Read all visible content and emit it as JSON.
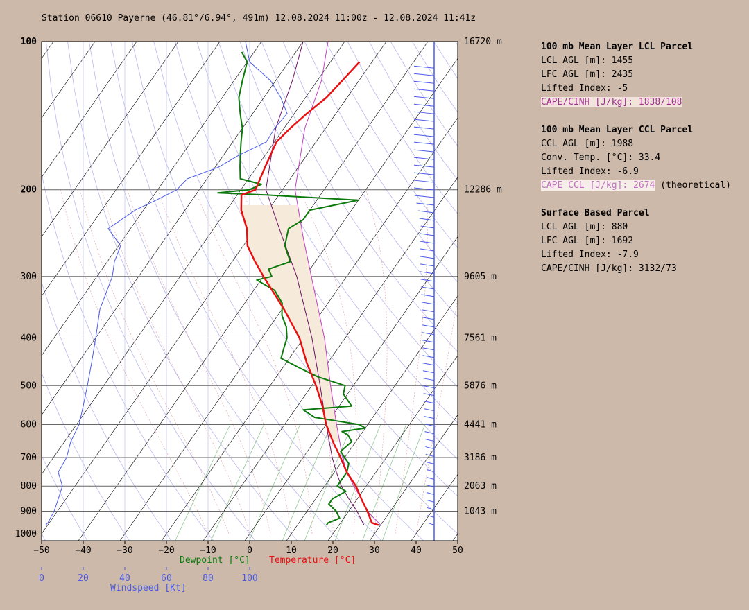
{
  "title": "Station 06610 Payerne (46.81°/6.94°, 491m) 12.08.2024 11:00z - 12.08.2024 11:41z",
  "axes": {
    "temp_ticks": [
      "−50",
      "−40",
      "−30",
      "−20",
      "−10",
      "0",
      "10",
      "20",
      "30",
      "40",
      "50"
    ],
    "wind_ticks": [
      "0",
      "20",
      "40",
      "60",
      "80",
      "100"
    ],
    "pressure_ticks": [
      "100",
      "200",
      "300",
      "400",
      "500",
      "600",
      "700",
      "800",
      "900",
      "1000"
    ],
    "height_labels": [
      "16720 m",
      "12286 m",
      "9605 m",
      "7561 m",
      "5876 m",
      "4441 m",
      "3186 m",
      "2063 m",
      "1043 m"
    ],
    "xlabel_dewpoint": "Dewpoint [°C]",
    "xlabel_temperature": "Temperature [°C]",
    "xlabel_wind": "Windspeed [Kt]"
  },
  "panel": {
    "lcl": {
      "header": "100 mb Mean Layer LCL Parcel",
      "lines": [
        "LCL AGL [m]: 1455",
        "LFC AGL [m]: 2435",
        "Lifted Index: -5"
      ],
      "cape": "CAPE/CINH [J/kg]: 1838/108"
    },
    "ccl": {
      "header": "100 mb Mean Layer CCL Parcel",
      "lines": [
        "CCL AGL [m]: 1988",
        "Conv. Temp. [°C]: 33.4",
        "Lifted Index: -6.9"
      ],
      "cape": "CAPE CCL [J/kg]: 2674",
      "note": " (theoretical)"
    },
    "sb": {
      "header": "Surface Based Parcel",
      "lines": [
        "LCL AGL [m]: 880",
        "LFC AGL [m]: 1692",
        "Lifted Index: -7.9",
        "CAPE/CINH [J/kg]: 3132/73"
      ]
    }
  },
  "colors": {
    "temperature": "#e81010",
    "dewpoint": "#0a7a0a",
    "wind": "#4a5ae8",
    "parcel_ml": "#6a1060",
    "parcel_ccl": "#c040c0",
    "cape_fill": "#f6eadb",
    "background": "#ccb9a9"
  },
  "chart_data": {
    "type": "skew-t",
    "title": "Station 06610 Payerne (46.81°/6.94°, 491m) 12.08.2024 11:00z - 12.08.2024 11:41z",
    "xlim": [
      -50,
      50
    ],
    "pressure_range": [
      1000,
      100
    ],
    "series": [
      {
        "name": "Temperature",
        "unit": "°C",
        "p": [
          960,
          950,
          900,
          850,
          800,
          750,
          700,
          650,
          600,
          550,
          500,
          450,
          400,
          350,
          300,
          280,
          260,
          240,
          220,
          205,
          200,
          180,
          160,
          150,
          140,
          130,
          120,
          110
        ],
        "t": [
          29.5,
          27.5,
          24.5,
          21.0,
          17.5,
          13.0,
          9.0,
          4.5,
          0.0,
          -4.0,
          -9.0,
          -15.0,
          -21.0,
          -29.5,
          -40.0,
          -44.5,
          -49.0,
          -52.0,
          -56.5,
          -59.0,
          -56.5,
          -58.0,
          -59.5,
          -58.5,
          -57.0,
          -55.0,
          -54.0,
          -53.0
        ]
      },
      {
        "name": "Dewpoint",
        "unit": "°C",
        "p": [
          960,
          950,
          930,
          900,
          870,
          850,
          820,
          800,
          780,
          750,
          720,
          700,
          680,
          650,
          630,
          620,
          610,
          600,
          590,
          580,
          560,
          550,
          520,
          500,
          480,
          460,
          440,
          420,
          400,
          380,
          360,
          340,
          320,
          310,
          305,
          300,
          290,
          280,
          270,
          260,
          250,
          240,
          230,
          220,
          210,
          205,
          203,
          200,
          195,
          190,
          180,
          170,
          160,
          150,
          140,
          130,
          120,
          110,
          105
        ],
        "td": [
          17.0,
          17.0,
          19.0,
          17.0,
          14.0,
          14.0,
          16.0,
          13.0,
          13.0,
          13.0,
          12.0,
          10.0,
          8.0,
          9.0,
          7.0,
          5.0,
          10.0,
          8.0,
          2.0,
          -4.0,
          -8.0,
          3.0,
          -1.0,
          -2.0,
          -10.0,
          -16.0,
          -22.0,
          -23.0,
          -24.0,
          -26.0,
          -29.0,
          -31.0,
          -35.0,
          -39.0,
          -41.0,
          -38.0,
          -40.0,
          -36.0,
          -38.0,
          -40.0,
          -41.0,
          -42.0,
          -40.0,
          -40.0,
          -30.0,
          -53.0,
          -65.0,
          -58.0,
          -56.0,
          -62.0,
          -64.0,
          -66.0,
          -68.0,
          -70.0,
          -73.0,
          -76.0,
          -78.0,
          -80.0,
          -83.0
        ]
      },
      {
        "name": "100 mb Mean Layer Parcel",
        "unit": "°C",
        "p": [
          960,
          900,
          850,
          800,
          750,
          700,
          600,
          500,
          400,
          300,
          250,
          200,
          150,
          120,
          100
        ],
        "t": [
          26.0,
          22.0,
          18.0,
          14.0,
          10.5,
          7.0,
          0.0,
          -8.0,
          -18.0,
          -32.0,
          -42.0,
          -54.0,
          -62.0,
          -66.0,
          -70.0
        ]
      },
      {
        "name": "CCL Parcel",
        "unit": "°C",
        "p": [
          960,
          900,
          850,
          800,
          750,
          700,
          600,
          500,
          400,
          300,
          250,
          200,
          150,
          120,
          100
        ],
        "t": [
          30.0,
          24.5,
          21.0,
          17.0,
          13.0,
          9.5,
          2.5,
          -5.5,
          -15.0,
          -28.5,
          -37.0,
          -47.0,
          -55.0,
          -59.0,
          -64.0
        ]
      }
    ],
    "wind_profile": {
      "unit": "kt",
      "p": [
        960,
        950,
        900,
        850,
        800,
        750,
        700,
        650,
        600,
        550,
        500,
        450,
        400,
        350,
        300,
        280,
        260,
        240,
        220,
        210,
        200,
        190,
        180,
        170,
        160,
        150,
        140,
        130,
        120,
        110,
        100
      ],
      "speed": [
        2,
        3,
        6,
        8,
        10,
        8,
        12,
        14,
        18,
        20,
        22,
        24,
        26,
        28,
        34,
        35,
        38,
        32,
        45,
        55,
        65,
        70,
        85,
        95,
        108,
        112,
        118,
        115,
        110,
        100,
        98
      ]
    }
  }
}
